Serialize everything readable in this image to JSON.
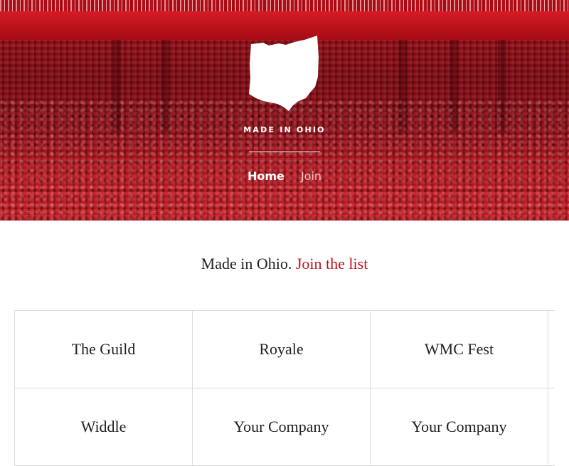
{
  "hero": {
    "brand": "MADE IN OHIO",
    "logo_icon": "ohio-state-shape-icon",
    "nav": {
      "home": "Home",
      "join": "Join"
    }
  },
  "intro": {
    "text": "Made in Ohio.",
    "link": "Join the list"
  },
  "companies": [
    [
      "The Guild",
      "Royale",
      "WMC Fest"
    ],
    [
      "Widdle",
      "Your Company",
      "Your Company"
    ]
  ],
  "colors": {
    "accent": "#c3101a",
    "hero_red": "#b80e17",
    "text": "#222222"
  }
}
